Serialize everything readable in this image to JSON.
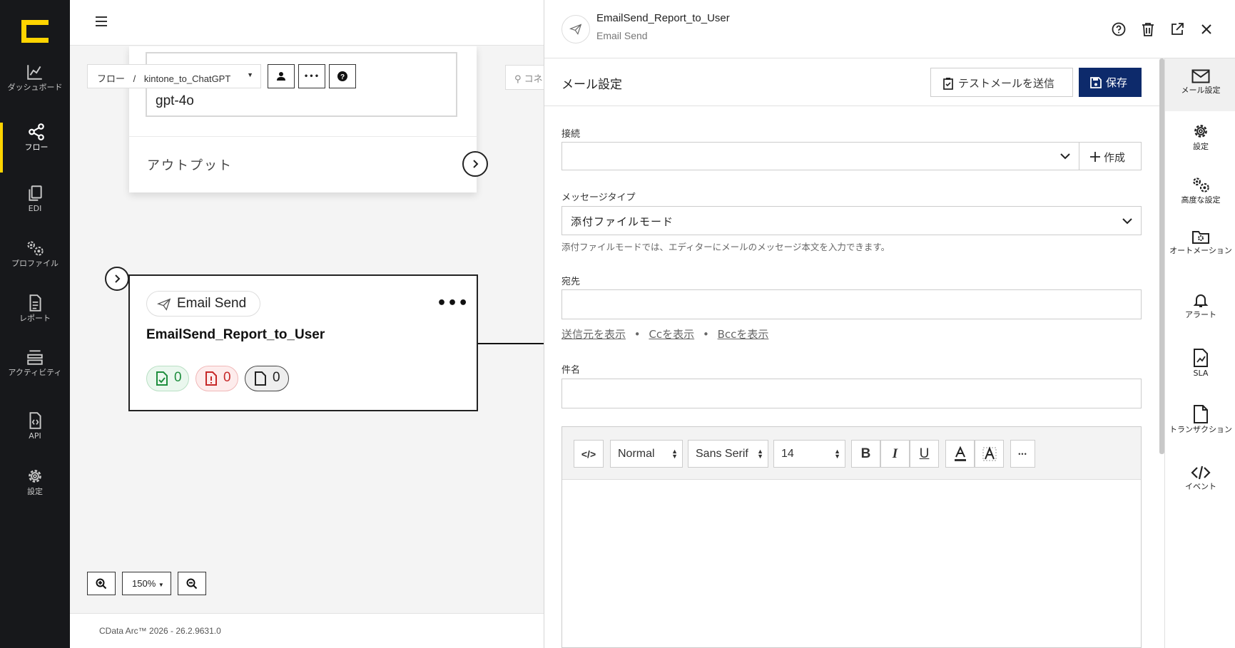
{
  "nav": {
    "items": [
      {
        "label": "ダッシュボード",
        "icon": "chart-icon"
      },
      {
        "label": "フロー",
        "icon": "share-icon"
      },
      {
        "label": "EDI",
        "icon": "copy-icon"
      },
      {
        "label": "プロファイル",
        "icon": "gears-icon"
      },
      {
        "label": "レポート",
        "icon": "document-icon"
      },
      {
        "label": "アクティビティ",
        "icon": "stack-icon"
      },
      {
        "label": "API",
        "icon": "code-file-icon"
      },
      {
        "label": "設定",
        "icon": "gear-icon"
      }
    ]
  },
  "canvas": {
    "breadcrumb": {
      "root": "フロー",
      "sep": "/",
      "flow": "kintone_to_ChatGPT"
    },
    "search_placeholder": "コネ",
    "top_card": {
      "model": "gpt-4o",
      "output_label": "アウトプット"
    },
    "email_card": {
      "type_label": "Email Send",
      "name": "EmailSend_Report_to_User",
      "more": "•••",
      "counts": {
        "success": "0",
        "error": "0",
        "pending": "0"
      }
    },
    "zoom_level": "150%",
    "footer": "CData Arc™ 2026 - 26.2.9631.0"
  },
  "panel": {
    "title": "EmailSend_Report_to_User",
    "subtitle": "Email Send",
    "section_title": "メール設定",
    "test_button": "テストメールを送信",
    "save_button": "保存",
    "fields": {
      "connection_label": "接続",
      "create_button": "作成",
      "message_type_label": "メッセージタイプ",
      "message_type_value": "添付ファイルモード",
      "message_type_help": "添付ファイルモードでは、エディターにメールのメッセージ本文を入力できます。",
      "to_label": "宛先",
      "show_from": "送信元を表示",
      "show_cc": "Ccを表示",
      "show_bcc": "Bccを表示",
      "separator": "•",
      "subject_label": "件名"
    },
    "editor": {
      "code_label": "</>",
      "format": "Normal",
      "font": "Sans Serif",
      "size": "14",
      "bold": "B",
      "italic": "I",
      "underline": "U",
      "more": "•••"
    }
  },
  "sidebar": {
    "items": [
      {
        "label": "メール設定",
        "icon": "mail-icon"
      },
      {
        "label": "設定",
        "icon": "gear-icon"
      },
      {
        "label": "高度な設定",
        "icon": "gears-icon"
      },
      {
        "label": "オートメーション",
        "icon": "folder-gear-icon"
      },
      {
        "label": "アラート",
        "icon": "bell-icon"
      },
      {
        "label": "SLA",
        "icon": "chart-file-icon"
      },
      {
        "label": "トランザクション",
        "icon": "file-icon"
      },
      {
        "label": "イベント",
        "icon": "code-icon"
      }
    ]
  },
  "colors": {
    "accent": "#ffd400",
    "primary": "#0d2a6b",
    "nav_bg": "#17181b",
    "success": "#1e8e3e",
    "error": "#c62828"
  }
}
